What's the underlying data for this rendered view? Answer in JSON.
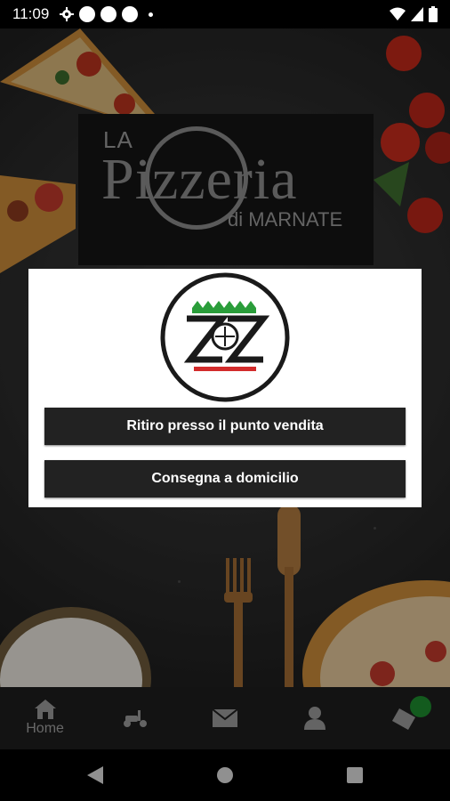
{
  "status_bar": {
    "time": "11:09"
  },
  "logo": {
    "line1": "LA",
    "line2": "Pizzeria",
    "line3": "di MARNATE"
  },
  "dialog": {
    "pickup_label": "Ritiro presso il punto vendita",
    "delivery_label": "Consegna a domicilio"
  },
  "bottom_nav": {
    "items": [
      {
        "icon": "home-icon",
        "label": "Home"
      },
      {
        "icon": "scooter-icon",
        "label": ""
      },
      {
        "icon": "mail-icon",
        "label": ""
      },
      {
        "icon": "user-icon",
        "label": ""
      },
      {
        "icon": "eraser-icon",
        "label": ""
      }
    ]
  },
  "colors": {
    "badge": "#1e8c2e",
    "button": "#222222",
    "italy_green": "#2a9d3a",
    "italy_red": "#d22b2b"
  }
}
